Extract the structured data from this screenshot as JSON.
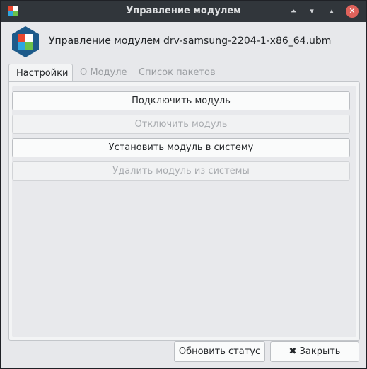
{
  "window": {
    "title": "Управление модулем",
    "controls": {
      "up_icon": "⏶",
      "min_icon": "▾",
      "max_icon": "▴",
      "close_icon": "✕"
    }
  },
  "header": {
    "module_title": "Управление модулем drv-samsung-2204-1-x86_64.ubm"
  },
  "tabs": [
    {
      "label": "Настройки",
      "active": true
    },
    {
      "label": "О Модуле",
      "active": false
    },
    {
      "label": "Список пакетов",
      "active": false
    }
  ],
  "actions": [
    {
      "label": "Подключить модуль",
      "enabled": true
    },
    {
      "label": "Отключить модуль",
      "enabled": false
    },
    {
      "label": "Установить модуль в систему",
      "enabled": true
    },
    {
      "label": "Удалить модуль из системы",
      "enabled": false
    }
  ],
  "footer": {
    "refresh_label": "Обновить статус",
    "close_label": "✖ Закрыть"
  },
  "colors": {
    "titlebar": "#31363b",
    "close_button": "#e0625b",
    "logo_hex": "#1d5a8a",
    "logo_red": "#e8472f",
    "logo_blue": "#2ea6e0",
    "logo_green": "#6cc24a"
  }
}
